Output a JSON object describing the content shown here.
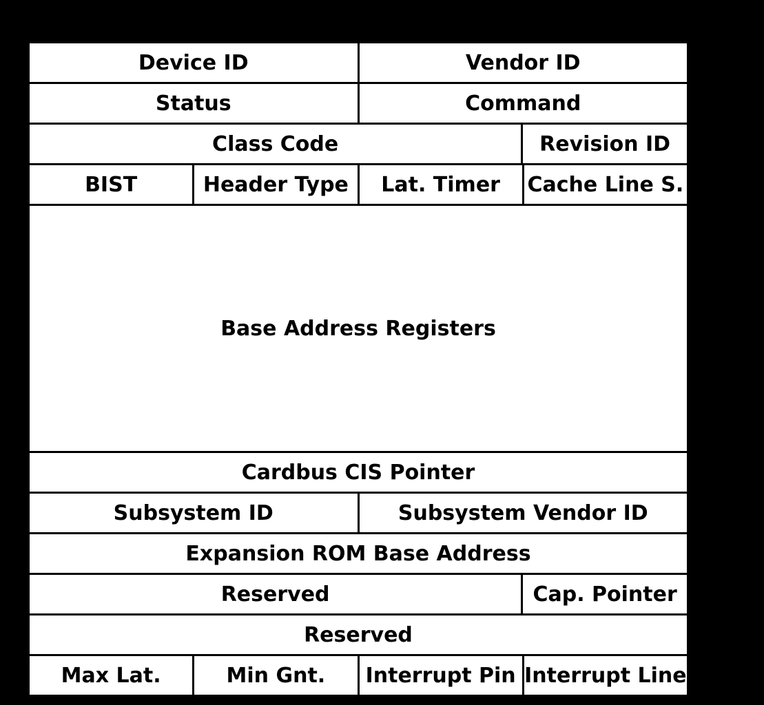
{
  "rows": [
    {
      "height": "std",
      "cells": [
        {
          "span": 2,
          "label": "Device ID"
        },
        {
          "span": 2,
          "label": "Vendor ID"
        }
      ]
    },
    {
      "height": "std",
      "cells": [
        {
          "span": 2,
          "label": "Status"
        },
        {
          "span": 2,
          "label": "Command"
        }
      ]
    },
    {
      "height": "std",
      "cells": [
        {
          "span": 3,
          "label": "Class Code"
        },
        {
          "span": 1,
          "label": "Revision ID"
        }
      ]
    },
    {
      "height": "std",
      "cells": [
        {
          "span": 1,
          "label": "BIST"
        },
        {
          "span": 1,
          "label": "Header Type"
        },
        {
          "span": 1,
          "label": "Lat. Timer"
        },
        {
          "span": 1,
          "label": "Cache Line S."
        }
      ]
    },
    {
      "height": "big",
      "cells": [
        {
          "span": 4,
          "label": "Base Address Registers"
        }
      ]
    },
    {
      "height": "std",
      "cells": [
        {
          "span": 4,
          "label": "Cardbus CIS Pointer"
        }
      ]
    },
    {
      "height": "std",
      "cells": [
        {
          "span": 2,
          "label": "Subsystem ID"
        },
        {
          "span": 2,
          "label": "Subsystem Vendor ID"
        }
      ]
    },
    {
      "height": "std",
      "cells": [
        {
          "span": 4,
          "label": "Expansion ROM Base Address"
        }
      ]
    },
    {
      "height": "std",
      "cells": [
        {
          "span": 3,
          "label": "Reserved"
        },
        {
          "span": 1,
          "label": "Cap. Pointer"
        }
      ]
    },
    {
      "height": "std",
      "cells": [
        {
          "span": 4,
          "label": "Reserved"
        }
      ]
    },
    {
      "height": "std",
      "cells": [
        {
          "span": 1,
          "label": "Max Lat."
        },
        {
          "span": 1,
          "label": "Min Gnt."
        },
        {
          "span": 1,
          "label": "Interrupt Pin"
        },
        {
          "span": 1,
          "label": "Interrupt Line"
        }
      ]
    }
  ]
}
